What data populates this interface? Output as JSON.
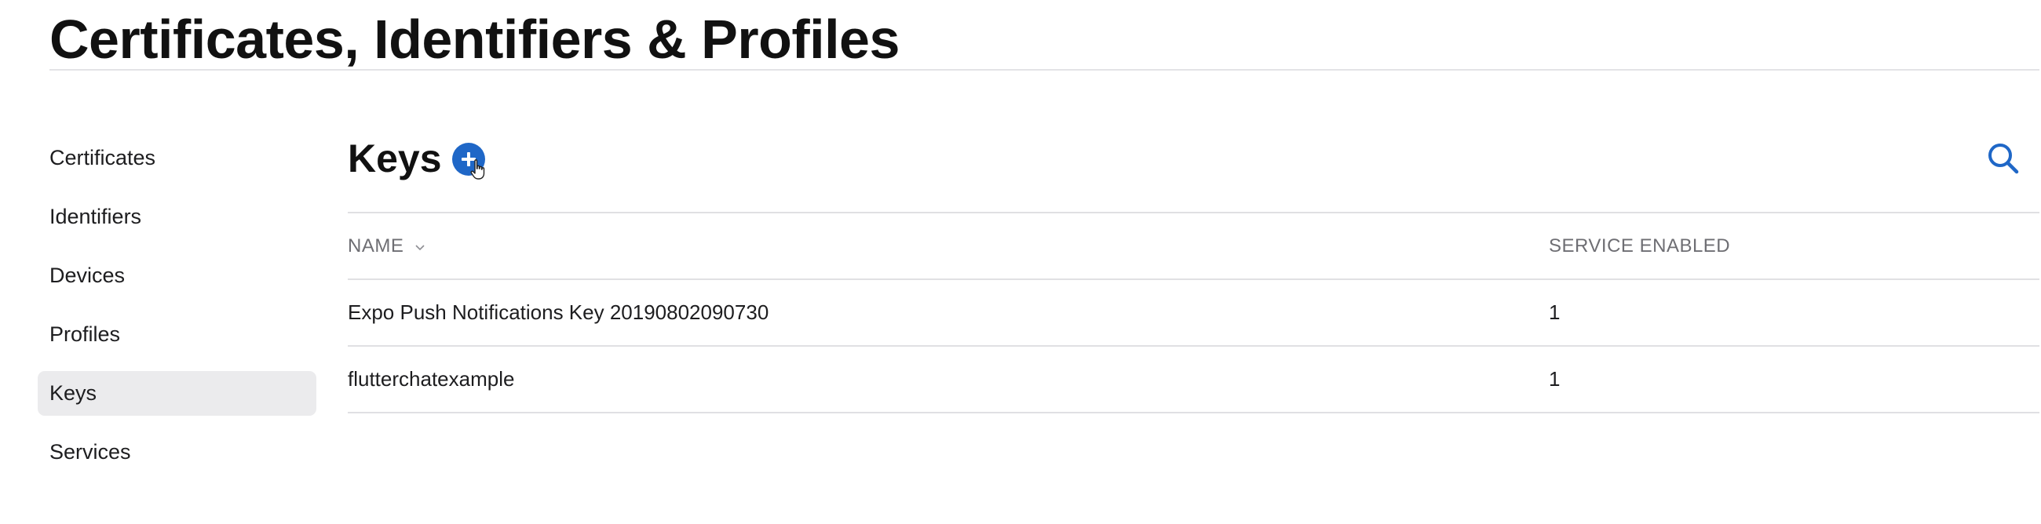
{
  "page": {
    "title": "Certificates, Identifiers & Profiles"
  },
  "sidebar": {
    "items": [
      {
        "label": "Certificates"
      },
      {
        "label": "Identifiers"
      },
      {
        "label": "Devices"
      },
      {
        "label": "Profiles"
      },
      {
        "label": "Keys",
        "active": true
      },
      {
        "label": "Services"
      }
    ]
  },
  "section": {
    "title": "Keys",
    "add_icon": "plus-circle-icon",
    "search_icon": "search-icon"
  },
  "table": {
    "columns": {
      "name": "NAME",
      "service_enabled": "SERVICE ENABLED"
    },
    "sort_icon": "chevron-down-icon",
    "rows": [
      {
        "name": "Expo Push Notifications Key 20190802090730",
        "service_enabled": "1"
      },
      {
        "name": "flutterchatexample",
        "service_enabled": "1"
      }
    ]
  },
  "colors": {
    "accent": "#1f67c7",
    "active_item_bg": "#ebebed",
    "divider": "#e0e0e3",
    "header_text": "#6e6e73"
  }
}
